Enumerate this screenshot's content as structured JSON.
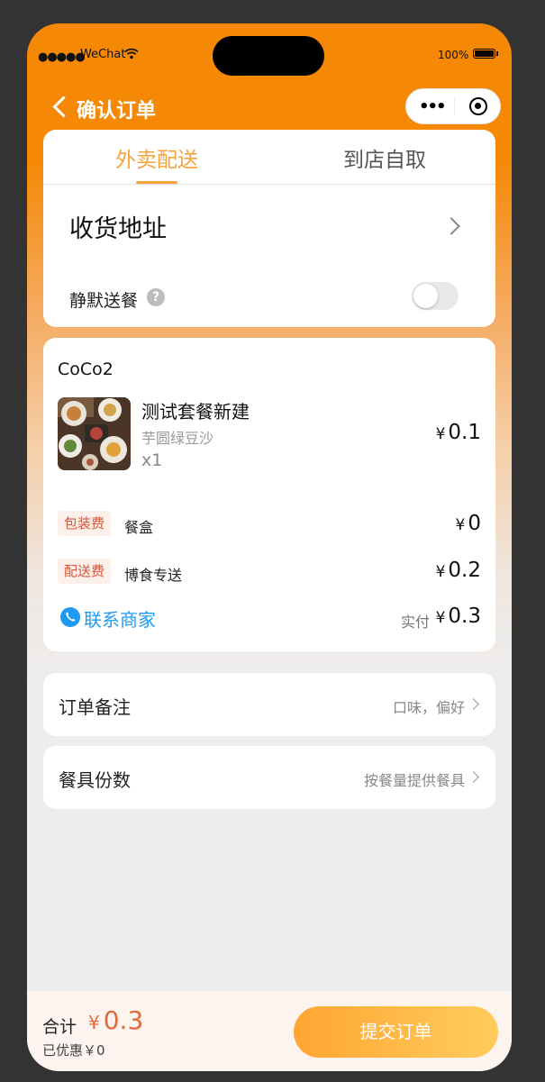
{
  "statusbar": {
    "signal": "●●●●●",
    "carrier": "WeChat",
    "battery_pct": "100%"
  },
  "nav": {
    "title": "确认订单"
  },
  "delivery": {
    "tabs": [
      {
        "label": "外卖配送",
        "active": true
      },
      {
        "label": "到店自取",
        "active": false
      }
    ],
    "address_label": "收货地址",
    "silent_label": "静默送餐",
    "silent_enabled": false
  },
  "order": {
    "shop_name": "CoCo2",
    "item": {
      "name": "测试套餐新建",
      "spec": "芋圆绿豆沙",
      "qty": "x1",
      "price": "0.1"
    },
    "fees": [
      {
        "tag": "包装费",
        "name": "餐盒",
        "price": "0"
      },
      {
        "tag": "配送费",
        "name": "博食专送",
        "price": "0.2"
      }
    ],
    "contact_label": "联系商家",
    "paid_label": "实付",
    "paid_price": "0.3",
    "currency": "¥"
  },
  "remark": {
    "label": "订单备注",
    "value": "口味，偏好"
  },
  "utensils": {
    "label": "餐具份数",
    "value": "按餐量提供餐具"
  },
  "footer": {
    "total_label": "合计",
    "total_amount": "0.3",
    "discount": "已优惠￥0",
    "submit_label": "提交订单"
  },
  "colors": {
    "brand": "#f58805",
    "accent": "#f5a33c",
    "price_red": "#e26a3a",
    "link": "#1e9bf0"
  }
}
